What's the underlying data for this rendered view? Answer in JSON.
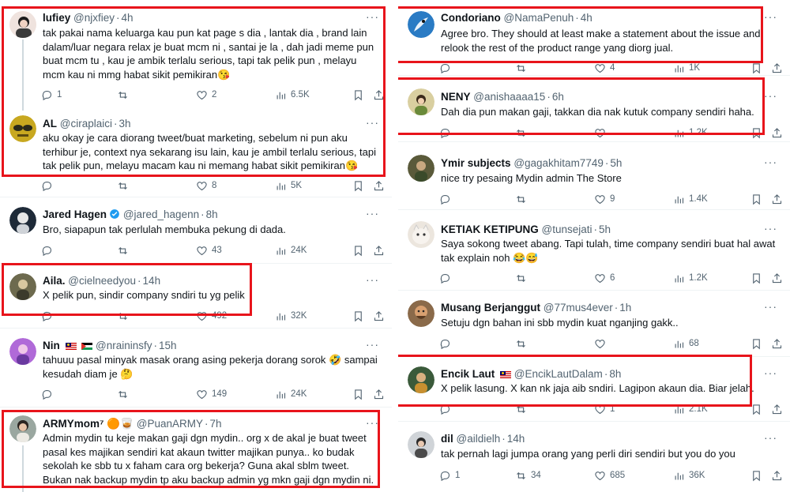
{
  "left": [
    {
      "name": "lufiey",
      "handle": "@njxfiey",
      "time": "4h",
      "text": "tak pakai nama keluarga kau pun kat page s dia , lantak dia , brand lain dalam/luar negara  relax je buat mcm ni , santai je la , dah jadi meme pun buat mcm tu , kau je ambik terlalu serious, tapi tak pelik pun , melayu mcm kau ni mmg habat sikit pemikiran😘",
      "reply": "1",
      "retweet": "",
      "like": "2",
      "views": "6.5K"
    },
    {
      "name": "AL",
      "handle": "@ciraplaici",
      "time": "3h",
      "text": "aku okay je cara diorang tweet/buat marketing, sebelum ni pun aku terhibur je, context nya sekarang isu lain, kau je ambil terlalu serious, tapi tak pelik pun, melayu macam kau ni memang habat sikit pemikiran😘",
      "reply": "",
      "retweet": "",
      "like": "8",
      "views": "5K"
    },
    {
      "name": "Jared Hagen",
      "handle": "@jared_hagenn",
      "time": "8h",
      "text": "Bro, siapapun tak perlulah membuka pekung di dada.",
      "reply": "",
      "retweet": "",
      "like": "43",
      "views": "24K"
    },
    {
      "name": "Aila.",
      "handle": "@cielneedyou",
      "time": "14h",
      "text": "X pelik pun, sindir company sndiri tu yg pelik",
      "reply": "",
      "retweet": "",
      "like": "492",
      "views": "32K"
    },
    {
      "name": "Nin",
      "handle": "@nraininsfy",
      "time": "15h",
      "text": "tahuuu pasal minyak masak orang asing pekerja dorang sorok 🤣 sampai kesudah diam je 🤔",
      "reply": "",
      "retweet": "",
      "like": "149",
      "views": "24K"
    },
    {
      "name": "ARMYmom⁷",
      "handle": "@PuanARMY",
      "time": "7h",
      "text": "Admin mydin tu keje makan gaji dgn mydin.. org x de akal je buat tweet pasal kes majikan sendiri kat akaun twitter majikan punya.. ko budak sekolah ke sbb tu x faham cara org bekerja? Guna akal sblm tweet. Bukan nak backup mydin tp aku backup admin yg mkn gaji dgn mydin ni.",
      "reply": "",
      "retweet": "",
      "like": "",
      "views": ""
    }
  ],
  "right": [
    {
      "name": "Condoriano",
      "handle": "@NamaPenuh",
      "time": "4h",
      "text": "Agree bro. They should at least make a statement about the issue and relook the rest of the product range yang diorg jual.",
      "reply": "",
      "retweet": "",
      "like": "4",
      "views": "1K"
    },
    {
      "name": "NENY",
      "handle": "@anishaaaa15",
      "time": "6h",
      "text": "Dah dia pun makan gaji, takkan dia nak kutuk company sendiri haha.",
      "reply": "",
      "retweet": "",
      "like": "",
      "views": "1.2K"
    },
    {
      "name": "Ymir subjects",
      "handle": "@gagakhitam7749",
      "time": "5h",
      "text": "nice try pesaing Mydin admin The Store",
      "reply": "",
      "retweet": "",
      "like": "9",
      "views": "1.4K"
    },
    {
      "name": "KETIAK KETIPUNG",
      "handle": "@tunsejati",
      "time": "5h",
      "text": "Saya sokong tweet abang. Tapi tulah, time company sendiri buat hal awat tak explain noh 😂😅",
      "reply": "",
      "retweet": "",
      "like": "6",
      "views": "1.2K"
    },
    {
      "name": "Musang Berjanggut",
      "handle": "@77mus4ever",
      "time": "1h",
      "text": "Setuju dgn bahan ini sbb mydin kuat nganjing gakk..",
      "reply": "",
      "retweet": "",
      "like": "",
      "views": "68"
    },
    {
      "name": "Encik Laut",
      "handle": "@EncikLautDalam",
      "time": "8h",
      "text": "X pelik lasung. X kan nk jaja aib sndiri. Lagipon akaun dia. Biar jelah.",
      "reply": "",
      "retweet": "",
      "like": "1",
      "views": "2.1K"
    },
    {
      "name": "dil",
      "handle": "@aildielh",
      "time": "14h",
      "text": "tak pernah lagi jumpa orang yang perli diri sendiri but you do you",
      "reply": "1",
      "retweet": "34",
      "like": "685",
      "views": "36K"
    }
  ],
  "more_label": "···",
  "colors": {
    "highlight": "#e8141b",
    "muted": "#536471",
    "verified": "#1d9bf0"
  },
  "icons": [
    "reply-icon",
    "retweet-icon",
    "like-icon",
    "views-icon",
    "bookmark-icon",
    "share-icon",
    "more-icon",
    "verified-icon"
  ]
}
